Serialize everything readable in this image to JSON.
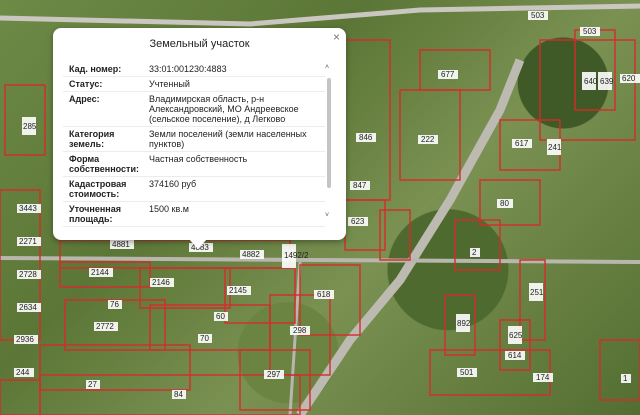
{
  "popup": {
    "title": "Земельный участок",
    "close": "×",
    "rows": [
      {
        "k": "Кад. номер:",
        "v": "33:01:001230:4883"
      },
      {
        "k": "Статус:",
        "v": "Учтенный"
      },
      {
        "k": "Адрес:",
        "v": "Владимирская область, р-н Александровский, МО Андреевское (сельское поселение), д Легково"
      },
      {
        "k": "Категория земель:",
        "v": "Земли поселений (земли населенных пунктов)"
      },
      {
        "k": "Форма собственности:",
        "v": "Частная собственность"
      },
      {
        "k": "Кадастровая стоимость:",
        "v": "374160 руб"
      },
      {
        "k": "Уточненная площадь:",
        "v": "1500 кв.м"
      }
    ],
    "scroll_up": "˄",
    "scroll_down": "˅"
  },
  "parcels": [
    "503",
    "503",
    "677",
    "640",
    "639",
    "620",
    "285",
    "846",
    "222",
    "617",
    "241",
    "847",
    "80",
    "623",
    "3443",
    "2271",
    "2728",
    "2634",
    "2936",
    "244",
    "4881",
    "4883",
    "4882",
    "1492/2",
    "2144",
    "2146",
    "2145",
    "76",
    "60",
    "70",
    "2772",
    "618",
    "298",
    "297",
    "27",
    "84",
    "2",
    "251",
    "892",
    "625",
    "614",
    "501",
    "174",
    "1"
  ],
  "colors": {
    "parcel_border": "#d62b2b",
    "road": "#b8b8b0"
  }
}
